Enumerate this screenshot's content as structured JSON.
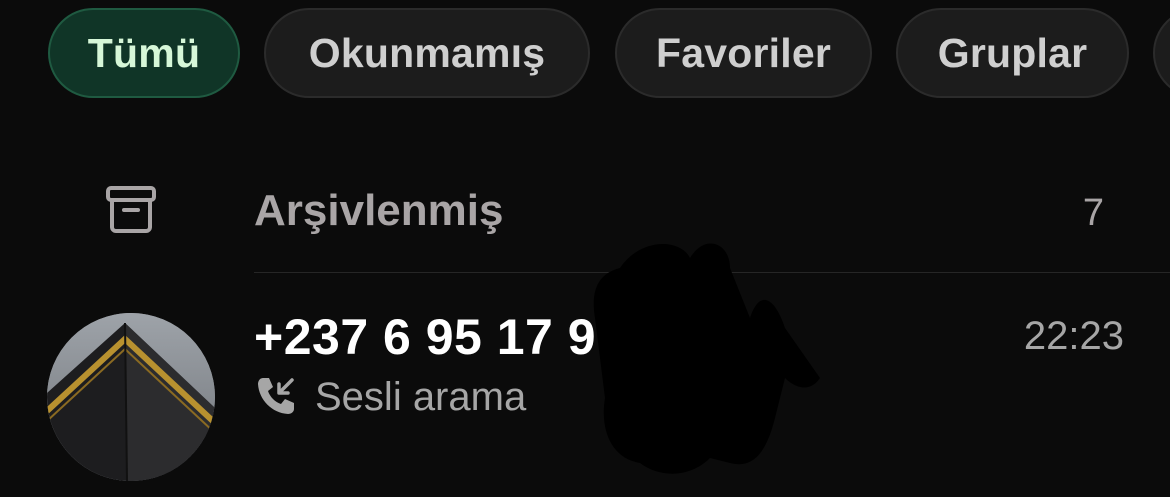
{
  "filters": {
    "items": [
      {
        "label": "Tümü",
        "active": true
      },
      {
        "label": "Okunmamış",
        "active": false
      },
      {
        "label": "Favoriler",
        "active": false
      },
      {
        "label": "Gruplar",
        "active": false
      },
      {
        "label": "",
        "active": false
      }
    ]
  },
  "archived": {
    "icon": "archive-box-icon",
    "label": "Arşivlenmiş",
    "count": "7"
  },
  "chats": [
    {
      "name": "+237 6 95 17 9",
      "time": "22:23",
      "preview_icon": "incoming-call-icon",
      "preview": "Sesli arama",
      "avatar": "kaaba-photo"
    }
  ],
  "colors": {
    "background": "#0b0b0b",
    "active_chip_bg": "#103527",
    "active_chip_text": "#d6f7d8",
    "chip_bg": "#1c1c1c",
    "muted_text": "#a6a6a6"
  }
}
